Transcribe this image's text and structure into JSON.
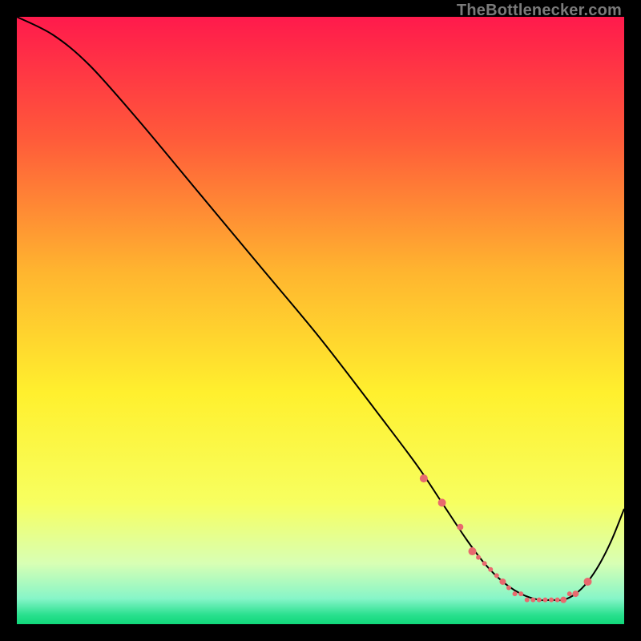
{
  "attribution": "TheBottlenecker.com",
  "colors": {
    "bg": "#000000",
    "curve": "#000000",
    "markers": "#e86a6e",
    "gradient_stops": [
      {
        "offset": 0.0,
        "color": "#ff1a4c"
      },
      {
        "offset": 0.2,
        "color": "#ff5a3a"
      },
      {
        "offset": 0.42,
        "color": "#ffb52f"
      },
      {
        "offset": 0.62,
        "color": "#fff02e"
      },
      {
        "offset": 0.8,
        "color": "#f7ff60"
      },
      {
        "offset": 0.9,
        "color": "#d8ffb4"
      },
      {
        "offset": 0.958,
        "color": "#86f5c8"
      },
      {
        "offset": 0.985,
        "color": "#29e08e"
      },
      {
        "offset": 1.0,
        "color": "#10d779"
      }
    ]
  },
  "chart_data": {
    "type": "line",
    "title": "",
    "xlabel": "",
    "ylabel": "",
    "xlim": [
      0,
      100
    ],
    "ylim": [
      0,
      100
    ],
    "series": [
      {
        "name": "curve",
        "x": [
          0,
          6,
          12,
          20,
          30,
          40,
          50,
          60,
          66,
          70,
          74,
          77,
          80,
          83,
          86,
          88,
          90,
          92,
          94,
          96,
          98,
          100
        ],
        "y": [
          100,
          97,
          92,
          83,
          71,
          59,
          47,
          34,
          26,
          20,
          14,
          10,
          7,
          5,
          4,
          4,
          4,
          5,
          7,
          10,
          14,
          19
        ]
      }
    ],
    "markers": {
      "name": "highlight",
      "x": [
        67,
        70,
        73,
        75,
        76,
        77,
        78,
        79,
        80,
        81,
        82,
        83,
        84,
        85,
        86,
        87,
        88,
        89,
        90,
        91,
        92,
        94
      ],
      "y": [
        24,
        20,
        16,
        12,
        11,
        10,
        9,
        8,
        7,
        6,
        5,
        5,
        4,
        4,
        4,
        4,
        4,
        4,
        4,
        5,
        5,
        7
      ],
      "r": [
        5,
        5,
        4,
        5,
        3,
        3,
        3,
        3,
        4,
        3,
        3,
        3,
        3,
        3,
        3,
        3,
        3,
        3,
        4,
        3,
        4,
        5
      ]
    }
  }
}
